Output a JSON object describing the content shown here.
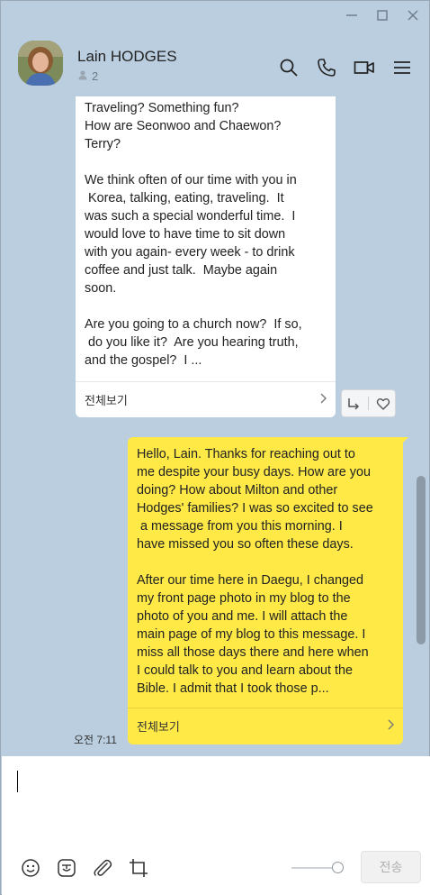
{
  "header": {
    "chat_name": "Lain HODGES",
    "member_count": "2"
  },
  "messages": {
    "incoming": {
      "text": "Traveling? Something fun?\nHow are Seonwoo and Chaewon?\nTerry?\n\nWe think often of our time with you in\n Korea, talking, eating, traveling.  It\nwas such a special wonderful time.  I\nwould love to have time to sit down\nwith you again- every week - to drink\ncoffee and just talk.  Maybe again\nsoon.\n\nAre you going to a church now?  If so,\n do you like it?  Are you hearing truth,\nand the gospel?  I ...",
      "see_all": "전체보기"
    },
    "outgoing": {
      "text": "Hello, Lain. Thanks for reaching out to\nme despite your busy days. How are you\ndoing? How about Milton and other\nHodges' families? I was so excited to see\n a message from you this morning. I\nhave missed you so often these days.\n\nAfter our time here in Daegu, I changed\nmy front page photo in my blog to the\nphoto of you and me. I will attach the\nmain page of my blog to this message. I\nmiss all those days there and here when\nI could talk to you and learn about the\nBible. I admit that I took those p...",
      "see_all": "전체보기",
      "timestamp": "오전 7:11"
    }
  },
  "input": {
    "value": "",
    "send_label": "전송"
  },
  "colors": {
    "chat_background": "#bacedf",
    "outgoing_bubble": "#fee947",
    "incoming_bubble": "#ffffff"
  },
  "icons": [
    "minimize-icon",
    "maximize-icon",
    "close-icon",
    "person-icon",
    "search-icon",
    "phone-icon",
    "video-icon",
    "menu-icon",
    "reply-icon",
    "heart-icon",
    "emoji-icon",
    "emoticon-icon",
    "attach-icon",
    "crop-icon",
    "chevron-right-icon"
  ]
}
